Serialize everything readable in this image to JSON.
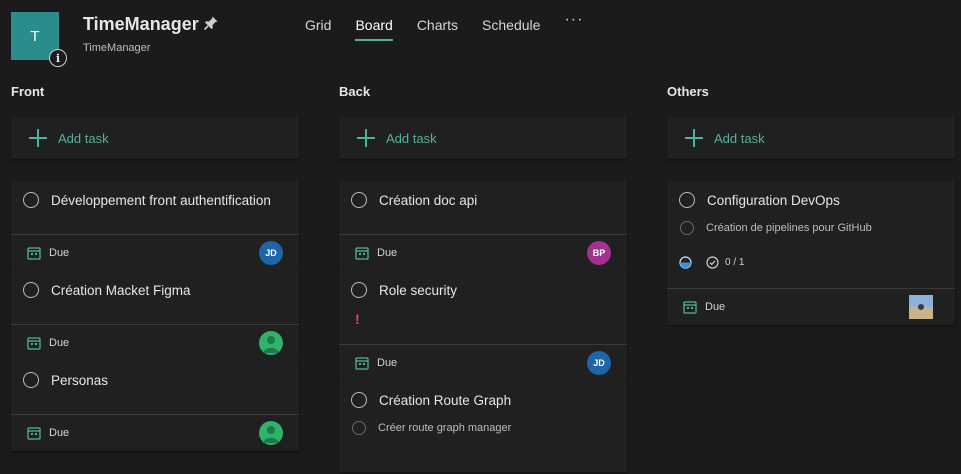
{
  "app": {
    "tile_letter": "T",
    "title": "TimeManager",
    "subtitle": "TimeManager",
    "info_glyph": "i"
  },
  "tabs": [
    {
      "label": "Grid"
    },
    {
      "label": "Board",
      "active": true
    },
    {
      "label": "Charts"
    },
    {
      "label": "Schedule"
    }
  ],
  "more_label": "···",
  "add_task_label": "Add task",
  "colors": {
    "accent": "#4fb39c",
    "tile": "#2a8c8c",
    "priority": "#e04b4b"
  },
  "columns": [
    {
      "name": "Front",
      "tasks": [
        {
          "title": "Développement front authentification",
          "due": "Due",
          "avatar": {
            "initials": "JD",
            "color": "#1f66a8"
          }
        },
        {
          "title": "Création Macket Figma",
          "due": "Due",
          "avatar": {
            "initials": "",
            "color": "#2fb36b"
          }
        },
        {
          "title": "Personas",
          "due": "Due",
          "avatar": {
            "initials": "",
            "color": "#2fb36b"
          }
        }
      ]
    },
    {
      "name": "Back",
      "tasks": [
        {
          "title": "Création doc api",
          "due": "Due",
          "avatar": {
            "initials": "BP",
            "color": "#a3318f"
          }
        },
        {
          "title": "Role security",
          "priority": "!",
          "due": "Due",
          "avatar": {
            "initials": "JD",
            "color": "#1f66a8"
          }
        },
        {
          "title": "Création Route Graph",
          "subtask": "Créer route graph manager"
        }
      ]
    },
    {
      "name": "Others",
      "tasks": [
        {
          "title": "Configuration DevOps",
          "subtask": "Création de pipelines pour GitHub",
          "checklist": "0 / 1",
          "due": "Due",
          "avatar": {
            "initials": "",
            "color": "#7a8ea8"
          }
        }
      ]
    }
  ]
}
